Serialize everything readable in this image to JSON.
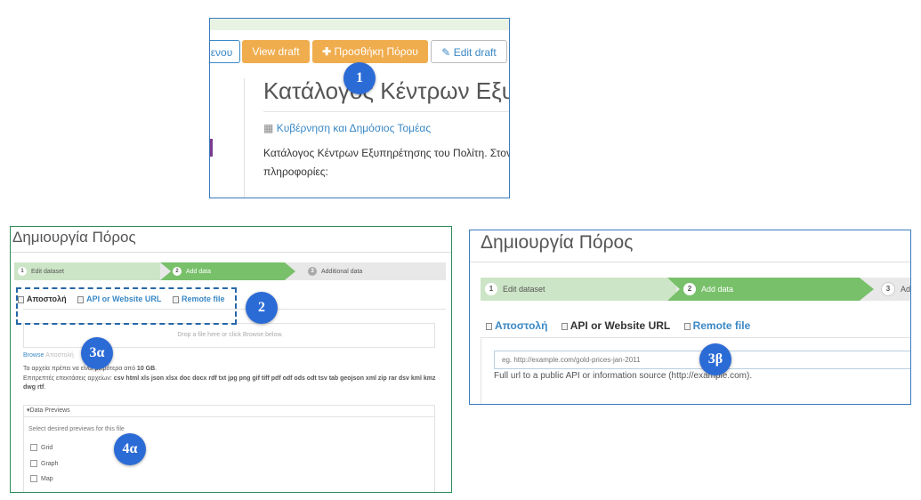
{
  "panel1": {
    "buttons": {
      "partial": "ενου",
      "view_draft": "View draft",
      "add_resource": "Προσθήκη Πόρου",
      "edit_draft": "Edit draft"
    },
    "title": "Κατάλογος Κέντρων Εξυπ",
    "category": "Κυβέρνηση και Δημόσιος Τομέας",
    "description_line1": "Κατάλογος Κέντρων Εξυπηρέτησης του Πολίτη. Στον",
    "description_line2": "πληροφορίες:"
  },
  "panel2": {
    "title": "Δημιουργία Πόρος",
    "stages": [
      {
        "num": "1",
        "label": "Edit dataset"
      },
      {
        "num": "2",
        "label": "Add data"
      },
      {
        "num": "3",
        "label": "Additional data"
      }
    ],
    "tabs": {
      "upload": "Αποστολή",
      "api": "API or Website URL",
      "remote": "Remote file"
    },
    "dropzone_text": "Drop a file here or click Browse below.",
    "browse": "Browse",
    "browse_sub": "Αποστολή",
    "size_info_prefix": "Τα αρχεία πρέπει να είναι μικρότερα από",
    "size_limit": "10 GB",
    "formats_label": "Επιτρεπτές επεκτάσεις αρχείων:",
    "formats": "csv html xls json xlsx doc docx rdf txt jpg png gif tiff pdf odf ods odt tsv tab geojson xml zip rar dsv kml kmz dwg rtf",
    "previews_header": "Data Previews",
    "previews_sub": "Select desired previews for this file",
    "preview_options": [
      "Grid",
      "Graph",
      "Map"
    ]
  },
  "panel3": {
    "title": "Δημιουργία Πόρος",
    "stages": [
      {
        "num": "1",
        "label": "Edit dataset"
      },
      {
        "num": "2",
        "label": "Add data"
      },
      {
        "num": "3",
        "label": "Add"
      }
    ],
    "tabs": {
      "upload": "Αποστολή",
      "api": "API or Website URL",
      "remote": "Remote file"
    },
    "url_placeholder": "eg. http://example.com/gold-prices-jan-2011",
    "help_text": "Full url to a public API or information source (http://example.com)."
  },
  "markers": {
    "m1": "1",
    "m2": "2",
    "m3a": "3α",
    "m3b": "3β",
    "m4a": "4α"
  },
  "colors": {
    "orange_button": "#f0ad4e",
    "stage_active": "#78c06a",
    "stage_done": "#cce5c6",
    "link_blue": "#3a88c5",
    "marker_blue": "#2b6bd6",
    "dash_blue": "#2566a8"
  },
  "icons": {
    "add": "plus-icon",
    "edit": "edit-icon",
    "category": "building-icon",
    "tab": "document-icon"
  }
}
